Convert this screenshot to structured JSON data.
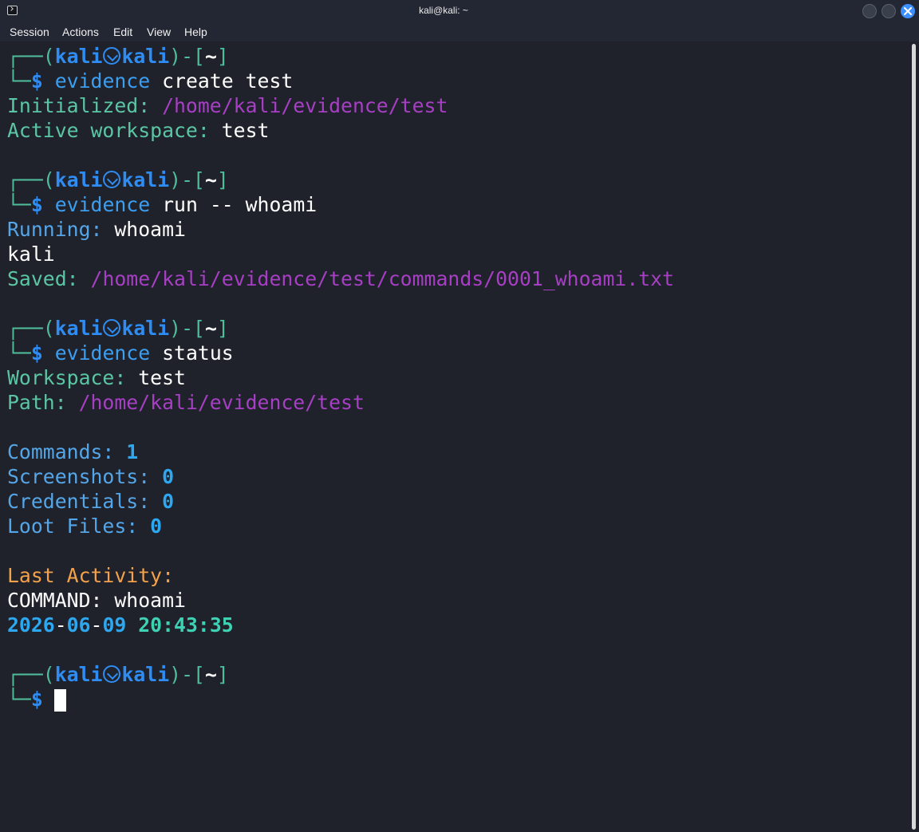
{
  "window": {
    "title": "kali@kali: ~",
    "accent_color": "#3d8fff"
  },
  "menu": {
    "session": "Session",
    "actions": "Actions",
    "edit": "Edit",
    "view": "View",
    "help": "Help"
  },
  "prompt": {
    "open": "┌──(",
    "user": "kali",
    "host": "kali",
    "mid": ")-[",
    "dir": "~",
    "close": "]",
    "corner": "└─",
    "dollar": "$"
  },
  "blocks": {
    "create": {
      "cmd_name": "evidence",
      "cmd_args": " create test",
      "initialized_label": "Initialized: ",
      "initialized_path": "/home/kali/evidence/test",
      "active_label": "Active workspace: ",
      "active_value": "test"
    },
    "run": {
      "cmd_name": "evidence",
      "cmd_args": " run -- whoami",
      "running_label": "Running: ",
      "running_value": "whoami",
      "output": "kali",
      "saved_label": "Saved: ",
      "saved_path": "/home/kali/evidence/test/commands/0001_whoami.txt"
    },
    "status": {
      "cmd_name": "evidence",
      "cmd_args": " status",
      "workspace_label": "Workspace: ",
      "workspace_value": "test",
      "path_label": "Path: ",
      "path_value": "/home/kali/evidence/test",
      "commands_label": "Commands: ",
      "commands_value": "1",
      "screenshots_label": "Screenshots: ",
      "screenshots_value": "0",
      "credentials_label": "Credentials: ",
      "credentials_value": "0",
      "loot_label": "Loot Files: ",
      "loot_value": "0",
      "last_activity_label": "Last Activity:",
      "last_command": "COMMAND: whoami",
      "date_year": "2026",
      "date_month": "06",
      "date_day": "09",
      "date_sep": "-",
      "time_value": "20:43:35"
    }
  }
}
